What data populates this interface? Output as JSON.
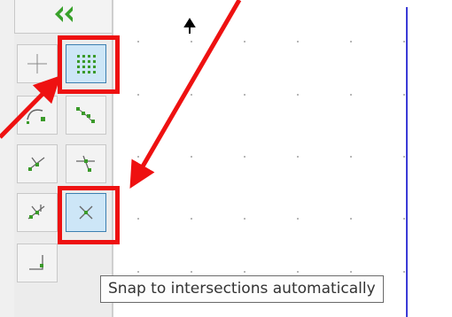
{
  "toolbar": {
    "buttons": [
      {
        "id": "collapse",
        "icon": "double-chevron-left-icon",
        "active": false
      },
      {
        "id": "crosshair",
        "icon": "crosshair-icon",
        "active": false
      },
      {
        "id": "grid-snap",
        "icon": "grid-snap-icon",
        "active": true
      },
      {
        "id": "curve-snap",
        "icon": "curve-snap-icon",
        "active": false
      },
      {
        "id": "node-snap",
        "icon": "node-snap-icon",
        "active": false
      },
      {
        "id": "path-snap",
        "icon": "path-snap-icon",
        "active": false
      },
      {
        "id": "midpoint-snap",
        "icon": "midpoint-snap-icon",
        "active": false
      },
      {
        "id": "cross-snap",
        "icon": "cross-snap-icon",
        "active": false
      },
      {
        "id": "intersection-snap",
        "icon": "intersection-snap-icon",
        "active": true
      },
      {
        "id": "corner-snap",
        "icon": "corner-snap-icon",
        "active": false
      }
    ]
  },
  "tooltip": {
    "text": "Snap to intersections automatically"
  },
  "annotation": {
    "color": "#ee1111",
    "highlighted": [
      "grid-snap",
      "intersection-snap"
    ]
  },
  "colors": {
    "accent_green": "#3a9a2a",
    "active_bg": "#cde6f7",
    "guide_line": "#3b3bd6"
  }
}
